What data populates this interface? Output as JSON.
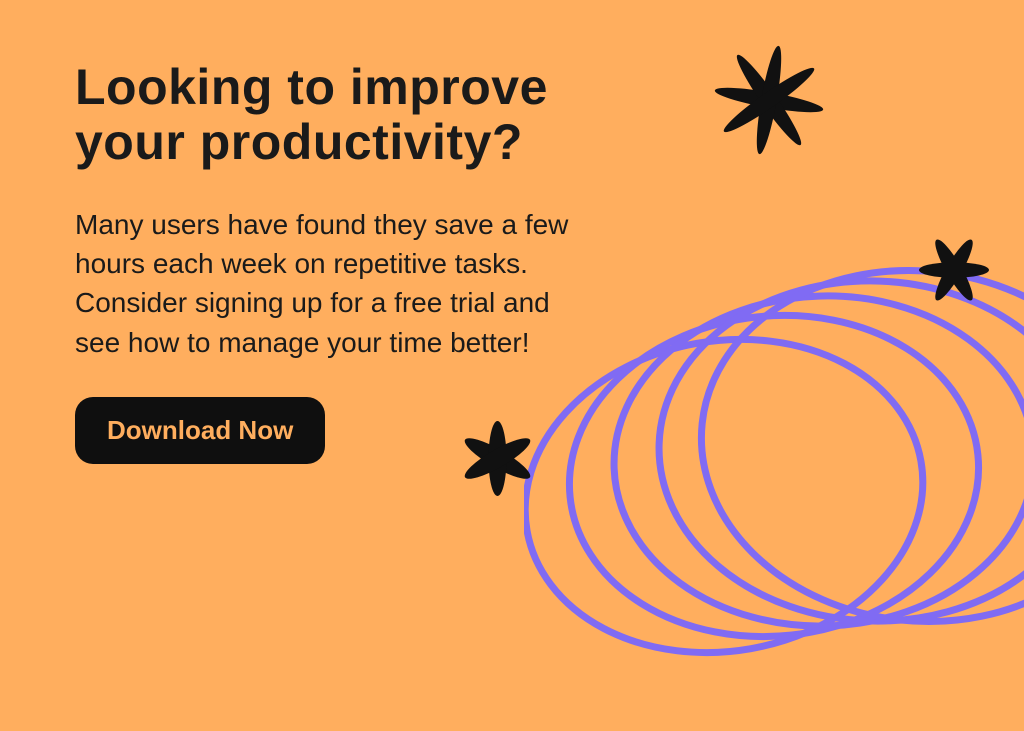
{
  "heading": "Looking to improve your productivity?",
  "body": "Many users have found they save a few hours each week on repetitive tasks. Consider signing up for a free trial and see how to manage your time better!",
  "cta": {
    "label": "Download Now"
  },
  "colors": {
    "bg": "#FFAE5E",
    "ink": "#0f0f0f",
    "accent": "#806BF3"
  }
}
